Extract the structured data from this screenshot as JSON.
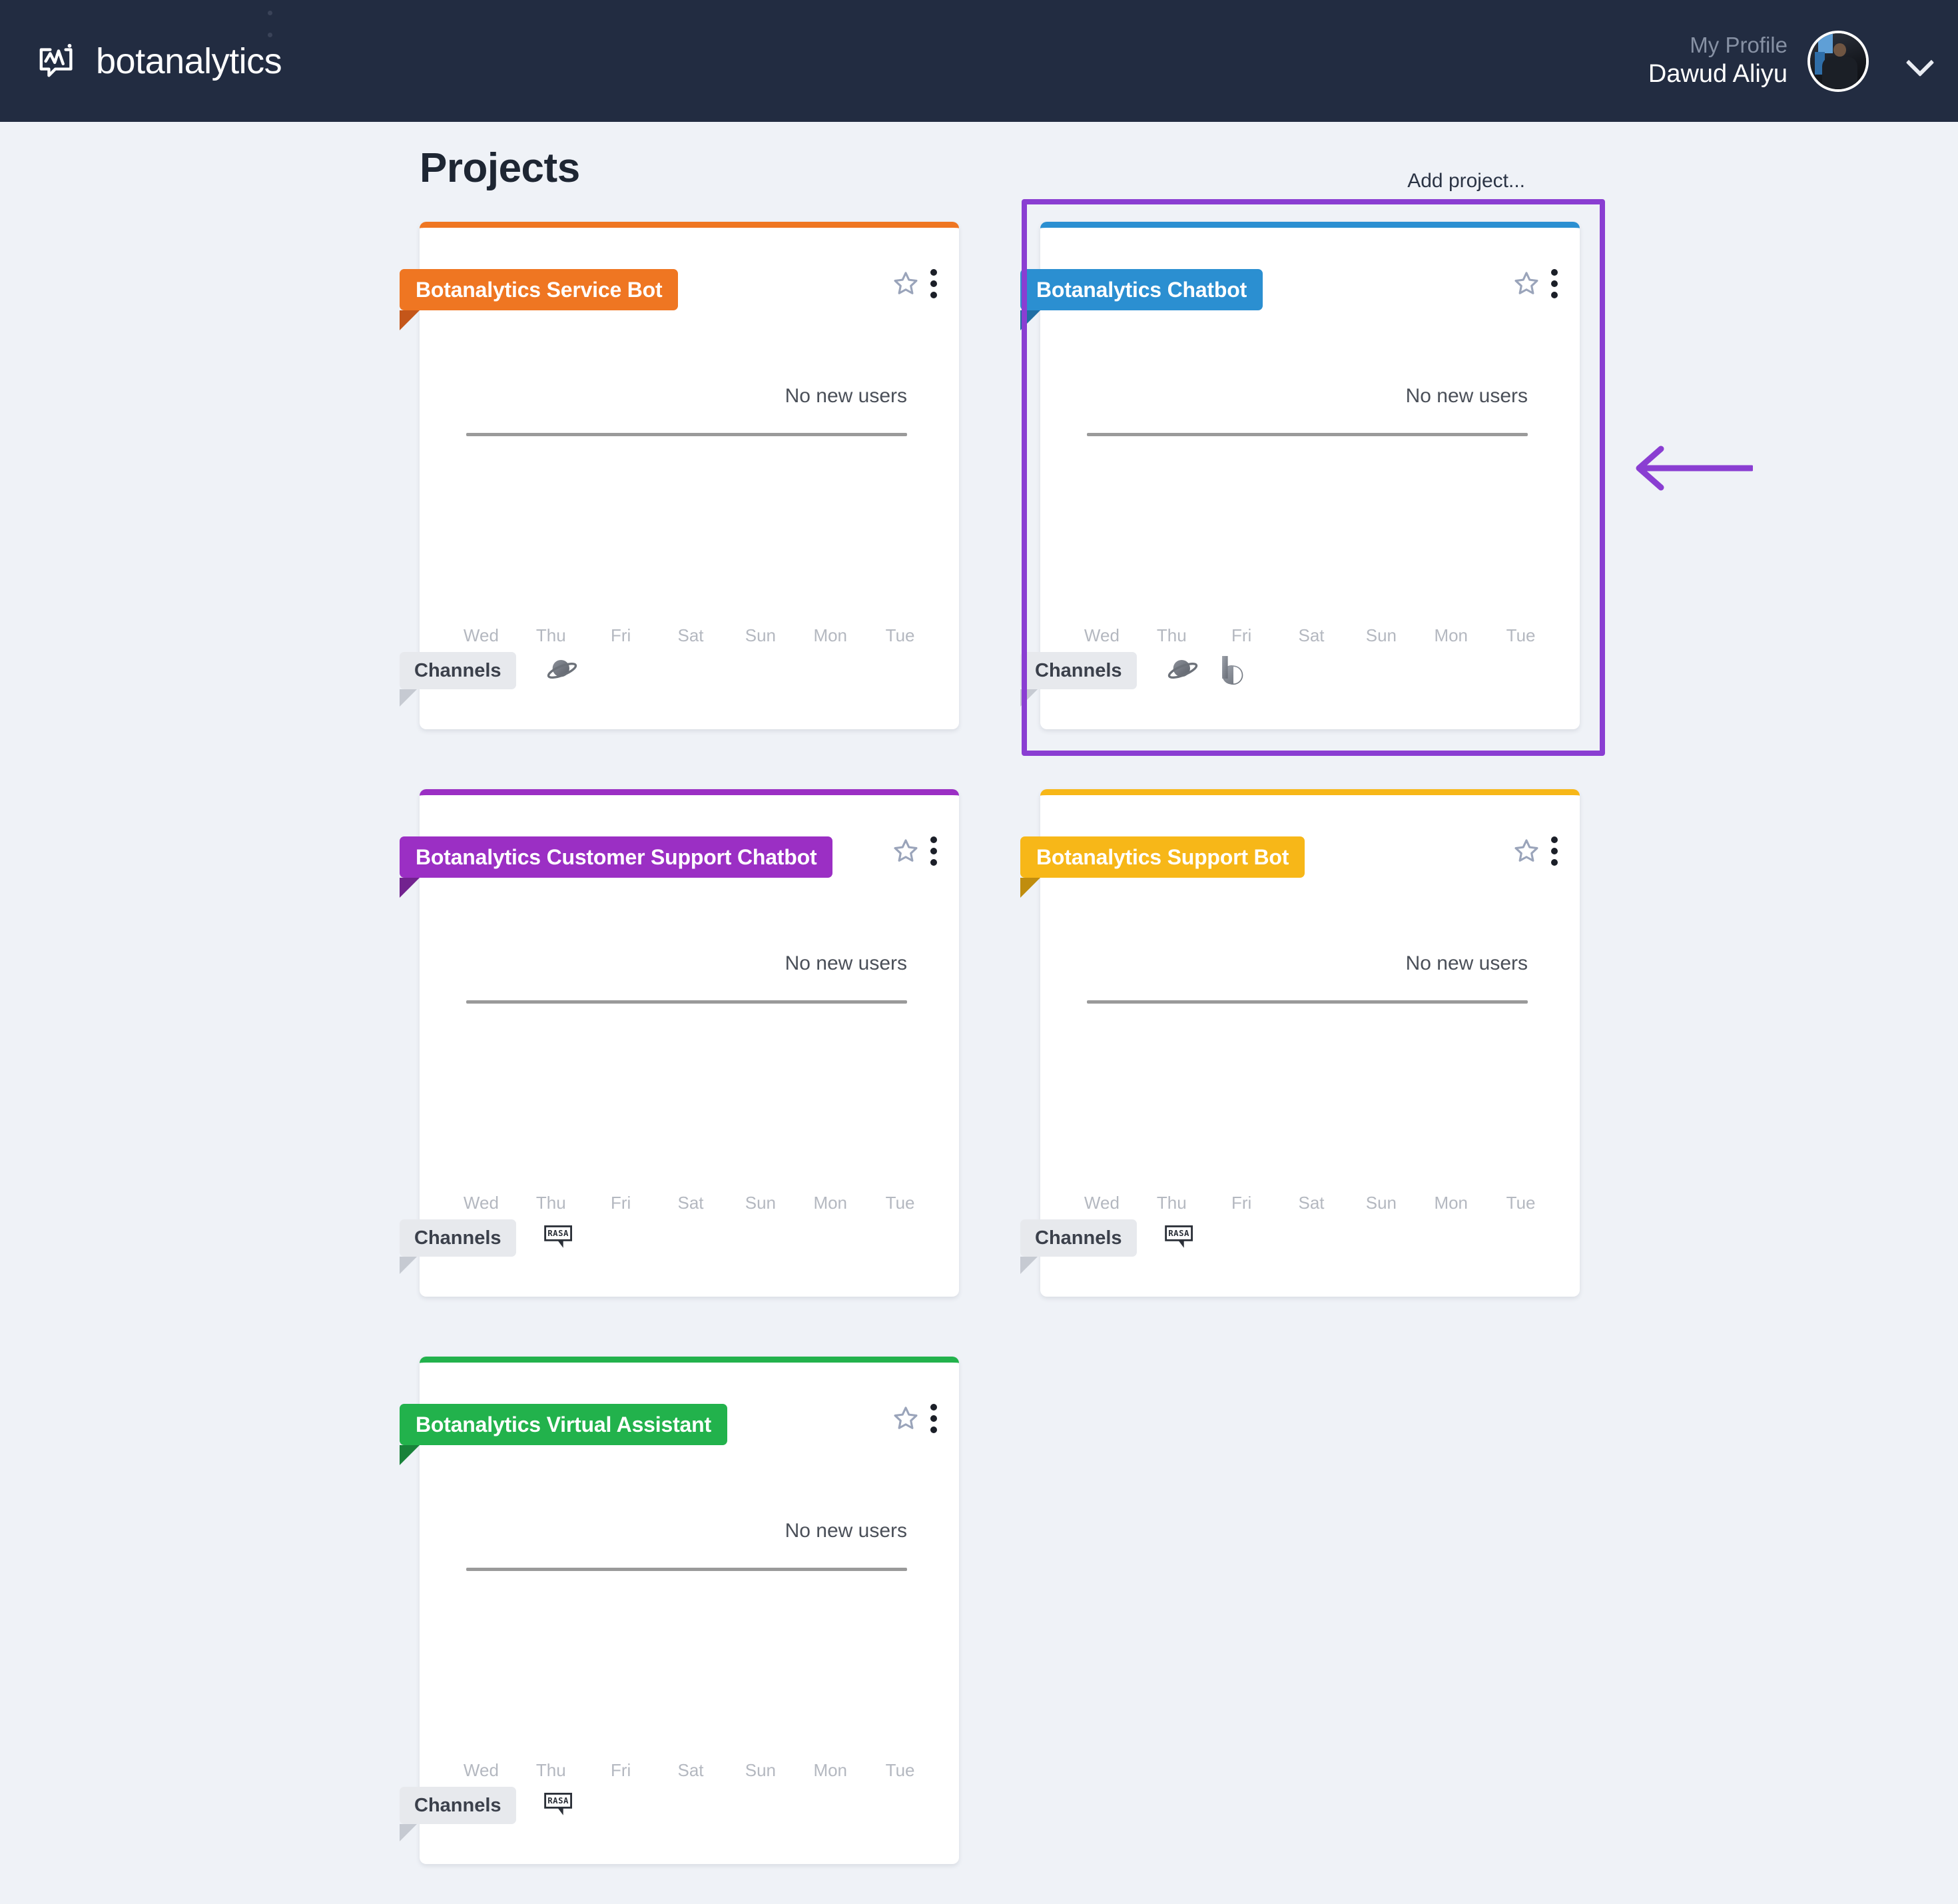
{
  "app": {
    "brand": "botanalytics",
    "brand_icon": "botanalytics-logo-icon",
    "topbar_bg": "#222c41"
  },
  "header": {
    "profile_label": "My Profile",
    "profile_name": "Dawud Aliyu",
    "avatar_icon": "user-avatar",
    "chevron_icon": "chevron-down-icon",
    "kebab_icon": "vertical-dots-icon"
  },
  "page": {
    "title": "Projects",
    "add_project": "Add project..."
  },
  "labels": {
    "channels": "Channels",
    "no_new_users": "No new users",
    "star_icon": "star-outline-icon",
    "kebab_icon": "vertical-dots-icon"
  },
  "annotation": {
    "highlight_color": "#8a3ed2",
    "arrow_icon": "left-arrow-icon",
    "highlighted_card": "Botanalytics Chatbot"
  },
  "chart_data": {
    "type": "line",
    "title": "No new users",
    "categories": [
      "Wed",
      "Thu",
      "Fri",
      "Sat",
      "Sun",
      "Mon",
      "Tue"
    ],
    "values": [
      0,
      0,
      0,
      0,
      0,
      0,
      0
    ],
    "ylim": [
      0,
      0
    ],
    "xlabel": "",
    "ylabel": "",
    "grid": false,
    "legend": "none",
    "note": "Flat zero baseline — no new users in the last 7 days"
  },
  "projects": [
    {
      "name": "Botanalytics Service Bot",
      "color": "#ef7622",
      "fold_color": "#c4561a",
      "chart_note": "No new users",
      "days": [
        "Wed",
        "Thu",
        "Fri",
        "Sat",
        "Sun",
        "Mon",
        "Tue"
      ],
      "values": [
        0,
        0,
        0,
        0,
        0,
        0,
        0
      ],
      "channels": [
        "dialogflow-icon"
      ],
      "highlighted": false
    },
    {
      "name": "Botanalytics Chatbot",
      "color": "#2b8fd1",
      "fold_color": "#1f6ea4",
      "chart_note": "No new users",
      "days": [
        "Wed",
        "Thu",
        "Fri",
        "Sat",
        "Sun",
        "Mon",
        "Tue"
      ],
      "values": [
        0,
        0,
        0,
        0,
        0,
        0,
        0
      ],
      "channels": [
        "dialogflow-icon",
        "bixby-icon"
      ],
      "highlighted": true
    },
    {
      "name": "Botanalytics Customer Support Chatbot",
      "color": "#9b2fc4",
      "fold_color": "#72228f",
      "chart_note": "No new users",
      "days": [
        "Wed",
        "Thu",
        "Fri",
        "Sat",
        "Sun",
        "Mon",
        "Tue"
      ],
      "values": [
        0,
        0,
        0,
        0,
        0,
        0,
        0
      ],
      "channels": [
        "rasa-icon"
      ],
      "highlighted": false
    },
    {
      "name": "Botanalytics Support Bot",
      "color": "#f7b718",
      "fold_color": "#c08d0e",
      "chart_note": "No new users",
      "days": [
        "Wed",
        "Thu",
        "Fri",
        "Sat",
        "Sun",
        "Mon",
        "Tue"
      ],
      "values": [
        0,
        0,
        0,
        0,
        0,
        0,
        0
      ],
      "channels": [
        "rasa-icon"
      ],
      "highlighted": false
    },
    {
      "name": "Botanalytics Virtual Assistant",
      "color": "#22b24c",
      "fold_color": "#18823a",
      "chart_note": "No new users",
      "days": [
        "Wed",
        "Thu",
        "Fri",
        "Sat",
        "Sun",
        "Mon",
        "Tue"
      ],
      "values": [
        0,
        0,
        0,
        0,
        0,
        0,
        0
      ],
      "channels": [
        "rasa-icon"
      ],
      "highlighted": false
    }
  ]
}
